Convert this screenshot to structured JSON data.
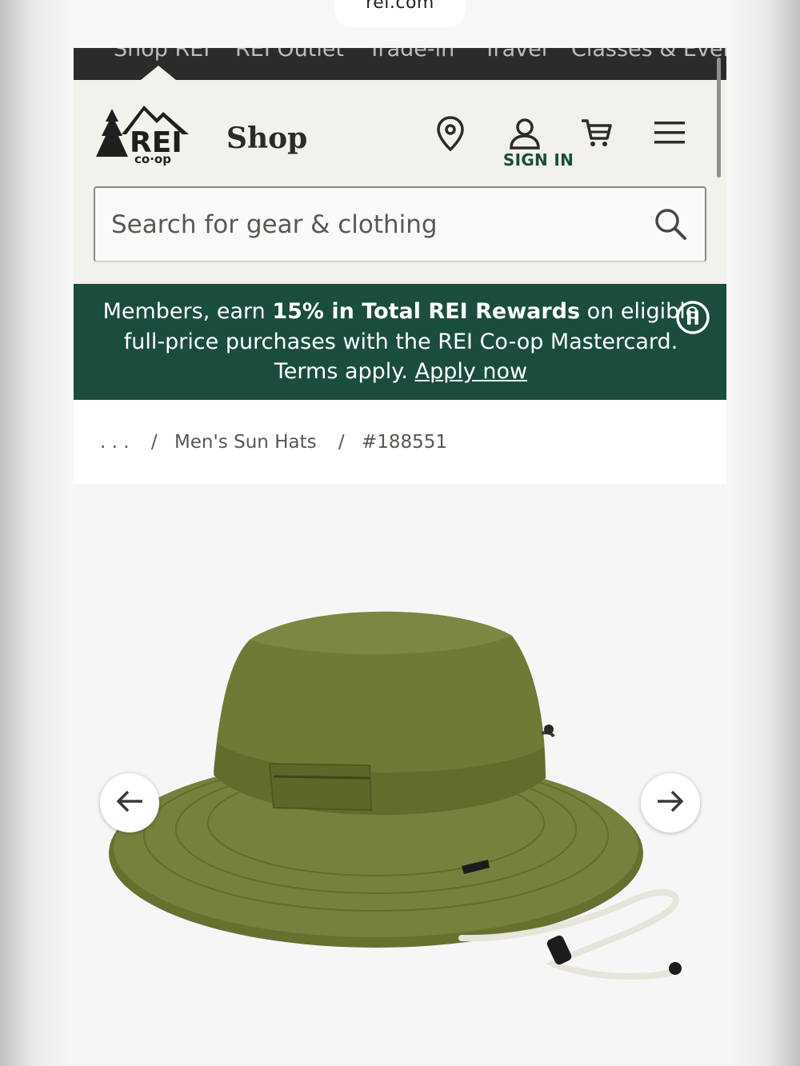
{
  "browser": {
    "url": "rei.com"
  },
  "top_nav": {
    "items": [
      "Shop REI",
      "REI Outlet",
      "Trade-in",
      "Travel",
      "Classes & Events"
    ]
  },
  "header": {
    "logo_text": "REI co-op",
    "shop_label": "Shop",
    "sign_in_label": "SIGN IN",
    "icons": [
      "location-pin-icon",
      "account-icon",
      "cart-icon",
      "menu-icon"
    ]
  },
  "search": {
    "placeholder": "Search for gear & clothing",
    "icon": "search-icon"
  },
  "promo_banner": {
    "text_before": "Members, earn ",
    "highlight": "15% in Total REI Rewards",
    "text_after": " on eligible",
    "line2": "full-price purchases with the REI Co-op Mastercard.",
    "line3_prefix": "Terms apply. ",
    "link": "Apply now",
    "background": "#1b4d3e"
  },
  "breadcrumb": {
    "ellipsis": ". . .",
    "sep": "/",
    "category": "Men's Sun Hats",
    "item_number": "#188551"
  },
  "gallery": {
    "prev_icon": "arrow-left-icon",
    "next_icon": "arrow-right-icon",
    "product_color": "#6f7a3a"
  },
  "colors": {
    "accent_green": "#1b4d3e",
    "nav_dark": "#2b2b2b",
    "header_bg": "#f2f1ec"
  }
}
